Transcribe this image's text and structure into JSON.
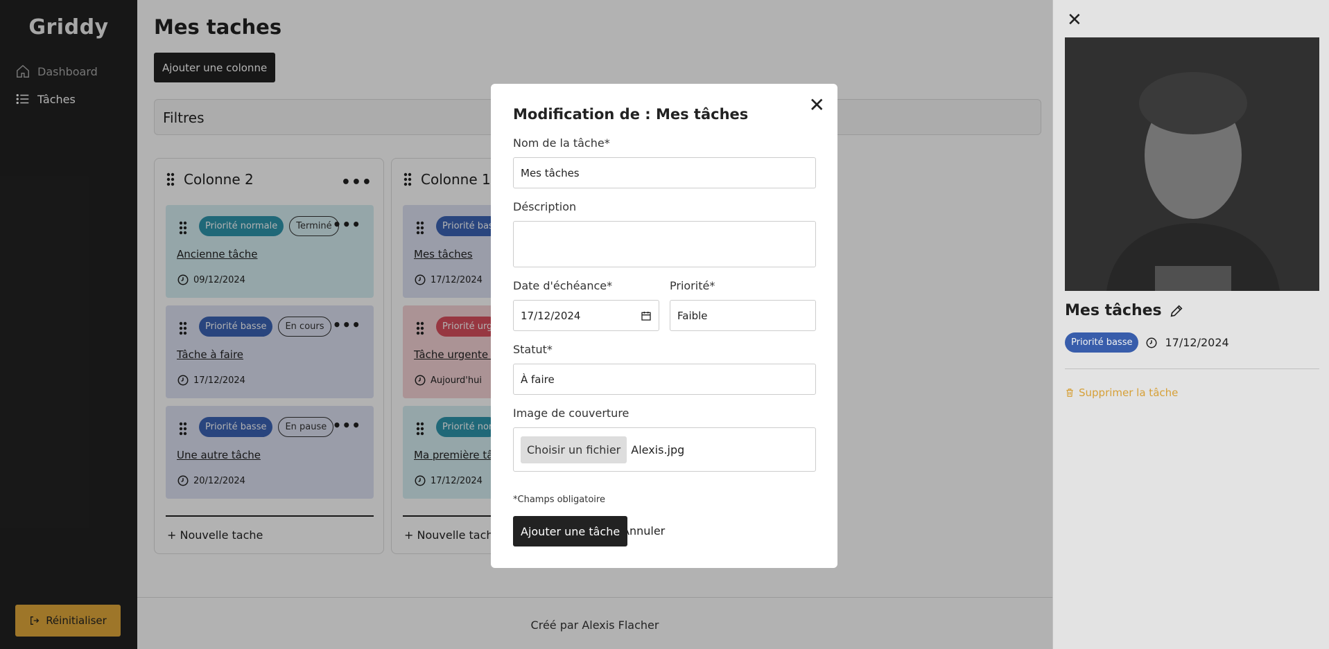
{
  "app": {
    "name": "Griddy"
  },
  "sidebar": {
    "items": [
      {
        "label": "Dashboard",
        "icon": "home-icon"
      },
      {
        "label": "Tâches",
        "icon": "list-icon"
      }
    ],
    "reset_label": "Réinitialiser"
  },
  "main": {
    "title": "Mes taches",
    "add_column_label": "Ajouter une colonne",
    "filters_label": "Filtres",
    "columns": [
      {
        "title": "Colonne 2",
        "cards": [
          {
            "priority": "Priorité normale",
            "status": "Terminé",
            "title": "Ancienne tâche",
            "date": "09/12/2024"
          },
          {
            "priority": "Priorité basse",
            "status": "En cours",
            "title": "Tâche à faire",
            "date": "17/12/2024"
          },
          {
            "priority": "Priorité basse",
            "status": "En pause",
            "title": "Une autre tâche",
            "date": "20/12/2024"
          }
        ],
        "new_task_label": "Nouvelle tache"
      },
      {
        "title": "Colonne 1",
        "cards": [
          {
            "priority": "Priorité bas",
            "title": "Mes tâches",
            "date": "17/12/2024"
          },
          {
            "priority": "Priorité urg",
            "title": "Tâche urgente !",
            "date": "Aujourd'hui"
          },
          {
            "priority": "Priorité nor",
            "title": "Ma première tâ",
            "date": "17/12/2024"
          }
        ],
        "new_task_label": "Nouvelle tache"
      }
    ],
    "footer": "Créé par Alexis Flacher"
  },
  "modal": {
    "title": "Modification de : Mes tâches",
    "name_label": "Nom de la tâche*",
    "name_value": "Mes tâches",
    "description_label": "Déscription",
    "description_value": "",
    "due_label": "Date d'échéance*",
    "due_value": "17/12/2024",
    "priority_label": "Priorité*",
    "priority_value": "Faible",
    "status_label": "Statut*",
    "status_value": "À faire",
    "cover_label": "Image de couverture",
    "file_button": "Choisir un fichier",
    "file_name": "Alexis.jpg",
    "required_note": "*Champs obligatoire",
    "submit_label": "Ajouter une tâche",
    "cancel_label": "Annuler"
  },
  "panel": {
    "title": "Mes tâches",
    "priority": "Priorité basse",
    "date": "17/12/2024",
    "delete_label": "Supprimer la tâche"
  },
  "colors": {
    "accent": "#e2a93b",
    "dark": "#222222",
    "priority_normal": "#2f95ad",
    "priority_low": "#3b63b5",
    "priority_urgent": "#d9505e"
  }
}
